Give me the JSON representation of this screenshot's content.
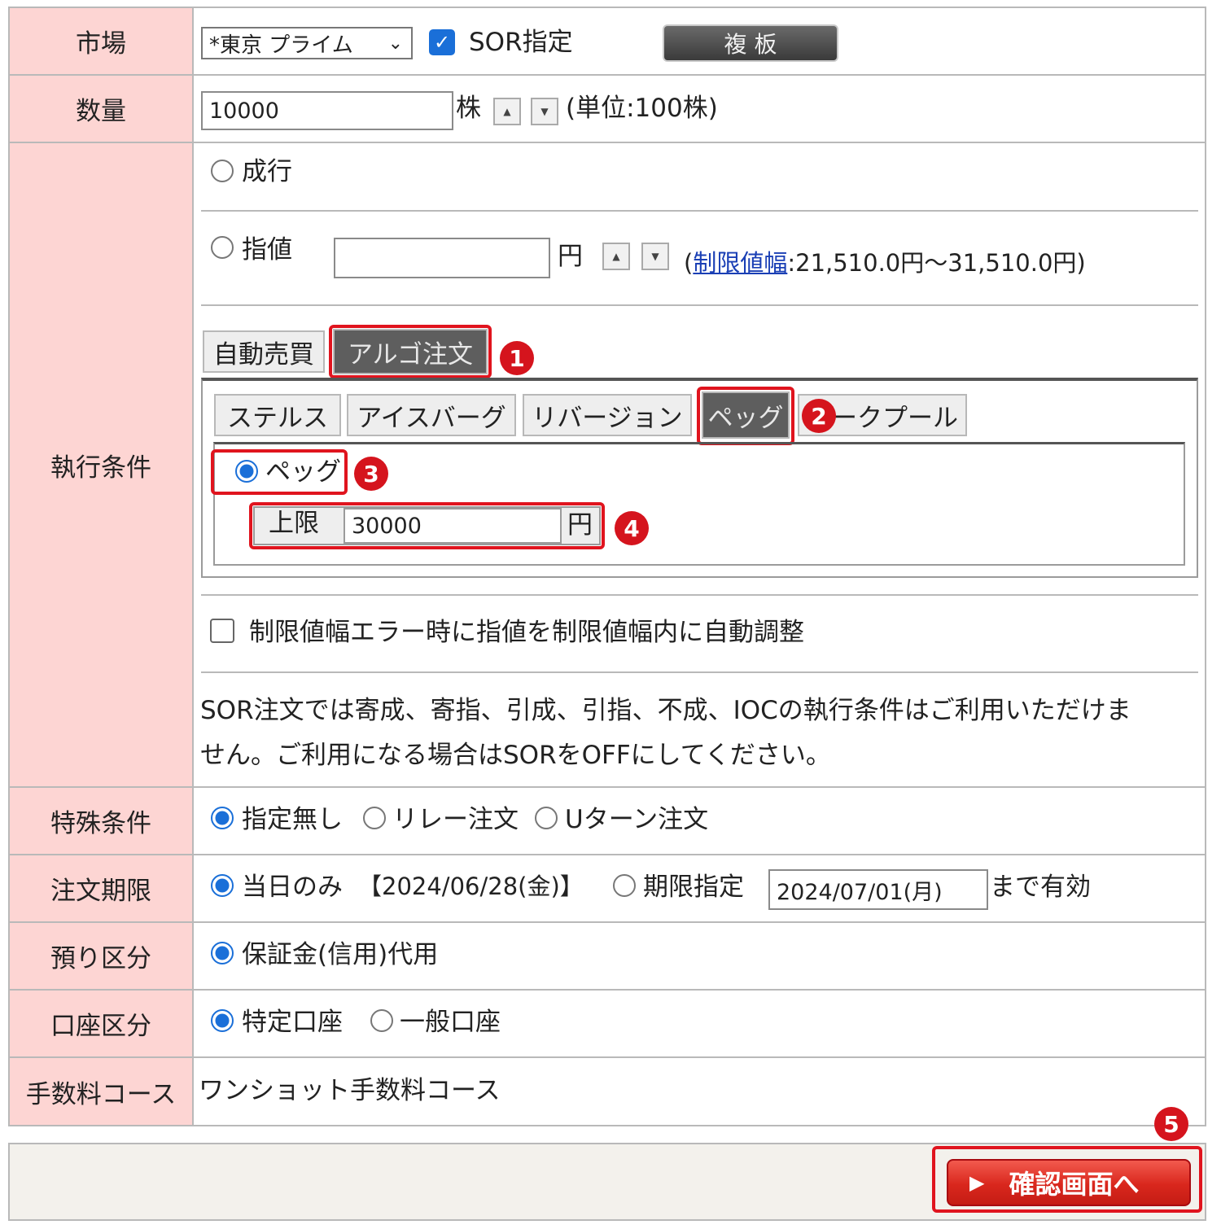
{
  "labels": {
    "market": "市場",
    "quantity": "数量",
    "execution": "執行条件",
    "special": "特殊条件",
    "expiry": "注文期限",
    "deposit": "預り区分",
    "account": "口座区分",
    "fee": "手数料コース"
  },
  "market": {
    "select_value": "*東京 プライム",
    "sor_label": "SOR指定",
    "sor_checked": true,
    "board_button": "複 板"
  },
  "quantity": {
    "value": "10000",
    "unit": "株",
    "unit_note": "(単位:100株)"
  },
  "execution": {
    "market_order": "成行",
    "limit_order": "指値",
    "limit_unit": "円",
    "price_range_prefix": "(",
    "price_range_link": "制限値幅",
    "price_range_text": ":21,510.0円〜31,510.0円)",
    "tabs_top": [
      "自動売買",
      "アルゴ注文"
    ],
    "tabs_algo": [
      "ステルス",
      "アイスバーグ",
      "リバージョン",
      "ペッグ",
      "ダークプール"
    ],
    "peg_radio_label": "ペッグ",
    "upper_label": "上限",
    "upper_value": "30000",
    "upper_unit": "円",
    "auto_adjust_label": "制限値幅エラー時に指値を制限値幅内に自動調整",
    "note_line1": "SOR注文では寄成、寄指、引成、引指、不成、IOCの執行条件はご利用いただけま",
    "note_line2": "せん。ご利用になる場合はSORをOFFにしてください。"
  },
  "special": {
    "options": [
      "指定無し",
      "リレー注文",
      "Uターン注文"
    ],
    "selected": "指定無し"
  },
  "expiry": {
    "today_label": "当日のみ",
    "today_date": "【2024/06/28(金)】",
    "custom_label": "期限指定",
    "custom_date": "2024/07/01(月)",
    "suffix": "まで有効"
  },
  "deposit": {
    "option": "保証金(信用)代用"
  },
  "account": {
    "options": [
      "特定口座",
      "一般口座"
    ],
    "selected": "特定口座"
  },
  "fee": {
    "value": "ワンショット手数料コース"
  },
  "confirm_button": "確認画面へ",
  "markers": [
    "1",
    "2",
    "3",
    "4",
    "5"
  ],
  "colors": {
    "label_bg": "#fdd5d3",
    "accent_red": "#e0141e",
    "link_blue": "#1a3fb5",
    "tab_active": "#5e5e5e",
    "radio_blue": "#1a6fd8"
  }
}
